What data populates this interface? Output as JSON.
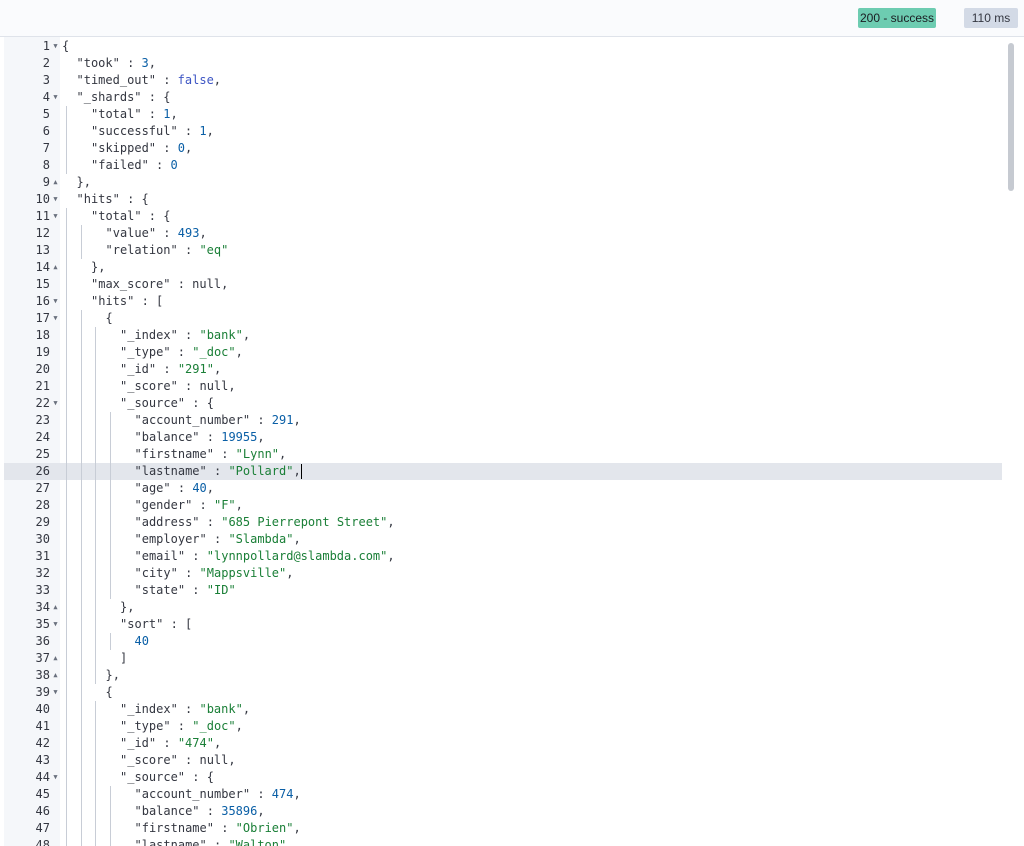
{
  "status": {
    "badge": "200 - success",
    "time": "110 ms"
  },
  "editor": {
    "active_line": 26,
    "lines": [
      [
        [
          "p",
          "{"
        ]
      ],
      [
        [
          "k",
          "\"took\""
        ],
        [
          "p",
          " : "
        ],
        [
          "n",
          "3"
        ],
        [
          "p",
          ","
        ]
      ],
      [
        [
          "k",
          "\"timed_out\""
        ],
        [
          "p",
          " : "
        ],
        [
          "b",
          "false"
        ],
        [
          "p",
          ","
        ]
      ],
      [
        [
          "k",
          "\"_shards\""
        ],
        [
          "p",
          " : {"
        ]
      ],
      [
        [
          "k",
          "\"total\""
        ],
        [
          "p",
          " : "
        ],
        [
          "n",
          "1"
        ],
        [
          "p",
          ","
        ]
      ],
      [
        [
          "k",
          "\"successful\""
        ],
        [
          "p",
          " : "
        ],
        [
          "n",
          "1"
        ],
        [
          "p",
          ","
        ]
      ],
      [
        [
          "k",
          "\"skipped\""
        ],
        [
          "p",
          " : "
        ],
        [
          "n",
          "0"
        ],
        [
          "p",
          ","
        ]
      ],
      [
        [
          "k",
          "\"failed\""
        ],
        [
          "p",
          " : "
        ],
        [
          "n",
          "0"
        ]
      ],
      [
        [
          "p",
          "},"
        ]
      ],
      [
        [
          "k",
          "\"hits\""
        ],
        [
          "p",
          " : {"
        ]
      ],
      [
        [
          "k",
          "\"total\""
        ],
        [
          "p",
          " : {"
        ]
      ],
      [
        [
          "k",
          "\"value\""
        ],
        [
          "p",
          " : "
        ],
        [
          "n",
          "493"
        ],
        [
          "p",
          ","
        ]
      ],
      [
        [
          "k",
          "\"relation\""
        ],
        [
          "p",
          " : "
        ],
        [
          "s",
          "\"eq\""
        ]
      ],
      [
        [
          "p",
          "},"
        ]
      ],
      [
        [
          "k",
          "\"max_score\""
        ],
        [
          "p",
          " : "
        ],
        [
          "p",
          "null"
        ],
        [
          "p",
          ","
        ]
      ],
      [
        [
          "k",
          "\"hits\""
        ],
        [
          "p",
          " : ["
        ]
      ],
      [
        [
          "p",
          "{"
        ]
      ],
      [
        [
          "k",
          "\"_index\""
        ],
        [
          "p",
          " : "
        ],
        [
          "s",
          "\"bank\""
        ],
        [
          "p",
          ","
        ]
      ],
      [
        [
          "k",
          "\"_type\""
        ],
        [
          "p",
          " : "
        ],
        [
          "s",
          "\"_doc\""
        ],
        [
          "p",
          ","
        ]
      ],
      [
        [
          "k",
          "\"_id\""
        ],
        [
          "p",
          " : "
        ],
        [
          "s",
          "\"291\""
        ],
        [
          "p",
          ","
        ]
      ],
      [
        [
          "k",
          "\"_score\""
        ],
        [
          "p",
          " : "
        ],
        [
          "p",
          "null"
        ],
        [
          "p",
          ","
        ]
      ],
      [
        [
          "k",
          "\"_source\""
        ],
        [
          "p",
          " : {"
        ]
      ],
      [
        [
          "k",
          "\"account_number\""
        ],
        [
          "p",
          " : "
        ],
        [
          "n",
          "291"
        ],
        [
          "p",
          ","
        ]
      ],
      [
        [
          "k",
          "\"balance\""
        ],
        [
          "p",
          " : "
        ],
        [
          "n",
          "19955"
        ],
        [
          "p",
          ","
        ]
      ],
      [
        [
          "k",
          "\"firstname\""
        ],
        [
          "p",
          " : "
        ],
        [
          "s",
          "\"Lynn\""
        ],
        [
          "p",
          ","
        ]
      ],
      [
        [
          "k",
          "\"lastname\""
        ],
        [
          "p",
          " : "
        ],
        [
          "s",
          "\"Pollard\""
        ],
        [
          "p",
          ","
        ]
      ],
      [
        [
          "k",
          "\"age\""
        ],
        [
          "p",
          " : "
        ],
        [
          "n",
          "40"
        ],
        [
          "p",
          ","
        ]
      ],
      [
        [
          "k",
          "\"gender\""
        ],
        [
          "p",
          " : "
        ],
        [
          "s",
          "\"F\""
        ],
        [
          "p",
          ","
        ]
      ],
      [
        [
          "k",
          "\"address\""
        ],
        [
          "p",
          " : "
        ],
        [
          "s",
          "\"685 Pierrepont Street\""
        ],
        [
          "p",
          ","
        ]
      ],
      [
        [
          "k",
          "\"employer\""
        ],
        [
          "p",
          " : "
        ],
        [
          "s",
          "\"Slambda\""
        ],
        [
          "p",
          ","
        ]
      ],
      [
        [
          "k",
          "\"email\""
        ],
        [
          "p",
          " : "
        ],
        [
          "s",
          "\"lynnpollard@slambda.com\""
        ],
        [
          "p",
          ","
        ]
      ],
      [
        [
          "k",
          "\"city\""
        ],
        [
          "p",
          " : "
        ],
        [
          "s",
          "\"Mappsville\""
        ],
        [
          "p",
          ","
        ]
      ],
      [
        [
          "k",
          "\"state\""
        ],
        [
          "p",
          " : "
        ],
        [
          "s",
          "\"ID\""
        ]
      ],
      [
        [
          "p",
          "},"
        ]
      ],
      [
        [
          "k",
          "\"sort\""
        ],
        [
          "p",
          " : ["
        ]
      ],
      [
        [
          "n",
          "40"
        ]
      ],
      [
        [
          "p",
          "]"
        ]
      ],
      [
        [
          "p",
          "},"
        ]
      ],
      [
        [
          "p",
          "{"
        ]
      ],
      [
        [
          "k",
          "\"_index\""
        ],
        [
          "p",
          " : "
        ],
        [
          "s",
          "\"bank\""
        ],
        [
          "p",
          ","
        ]
      ],
      [
        [
          "k",
          "\"_type\""
        ],
        [
          "p",
          " : "
        ],
        [
          "s",
          "\"_doc\""
        ],
        [
          "p",
          ","
        ]
      ],
      [
        [
          "k",
          "\"_id\""
        ],
        [
          "p",
          " : "
        ],
        [
          "s",
          "\"474\""
        ],
        [
          "p",
          ","
        ]
      ],
      [
        [
          "k",
          "\"_score\""
        ],
        [
          "p",
          " : "
        ],
        [
          "p",
          "null"
        ],
        [
          "p",
          ","
        ]
      ],
      [
        [
          "k",
          "\"_source\""
        ],
        [
          "p",
          " : {"
        ]
      ],
      [
        [
          "k",
          "\"account_number\""
        ],
        [
          "p",
          " : "
        ],
        [
          "n",
          "474"
        ],
        [
          "p",
          ","
        ]
      ],
      [
        [
          "k",
          "\"balance\""
        ],
        [
          "p",
          " : "
        ],
        [
          "n",
          "35896"
        ],
        [
          "p",
          ","
        ]
      ],
      [
        [
          "k",
          "\"firstname\""
        ],
        [
          "p",
          " : "
        ],
        [
          "s",
          "\"Obrien\""
        ],
        [
          "p",
          ","
        ]
      ],
      [
        [
          "k",
          "\"lastname\""
        ],
        [
          "p",
          " : "
        ],
        [
          "s",
          "\"Walton\""
        ],
        [
          "p",
          ","
        ]
      ]
    ],
    "fold_markers": {
      "1": "open",
      "4": "open",
      "9": "close",
      "10": "open",
      "11": "open",
      "14": "close",
      "16": "open",
      "17": "open",
      "22": "open",
      "34": "close",
      "35": "open",
      "37": "close",
      "38": "close",
      "39": "open",
      "44": "open"
    },
    "fold_icons": {
      "open": "fold-open-icon",
      "close": "fold-close-icon"
    }
  }
}
